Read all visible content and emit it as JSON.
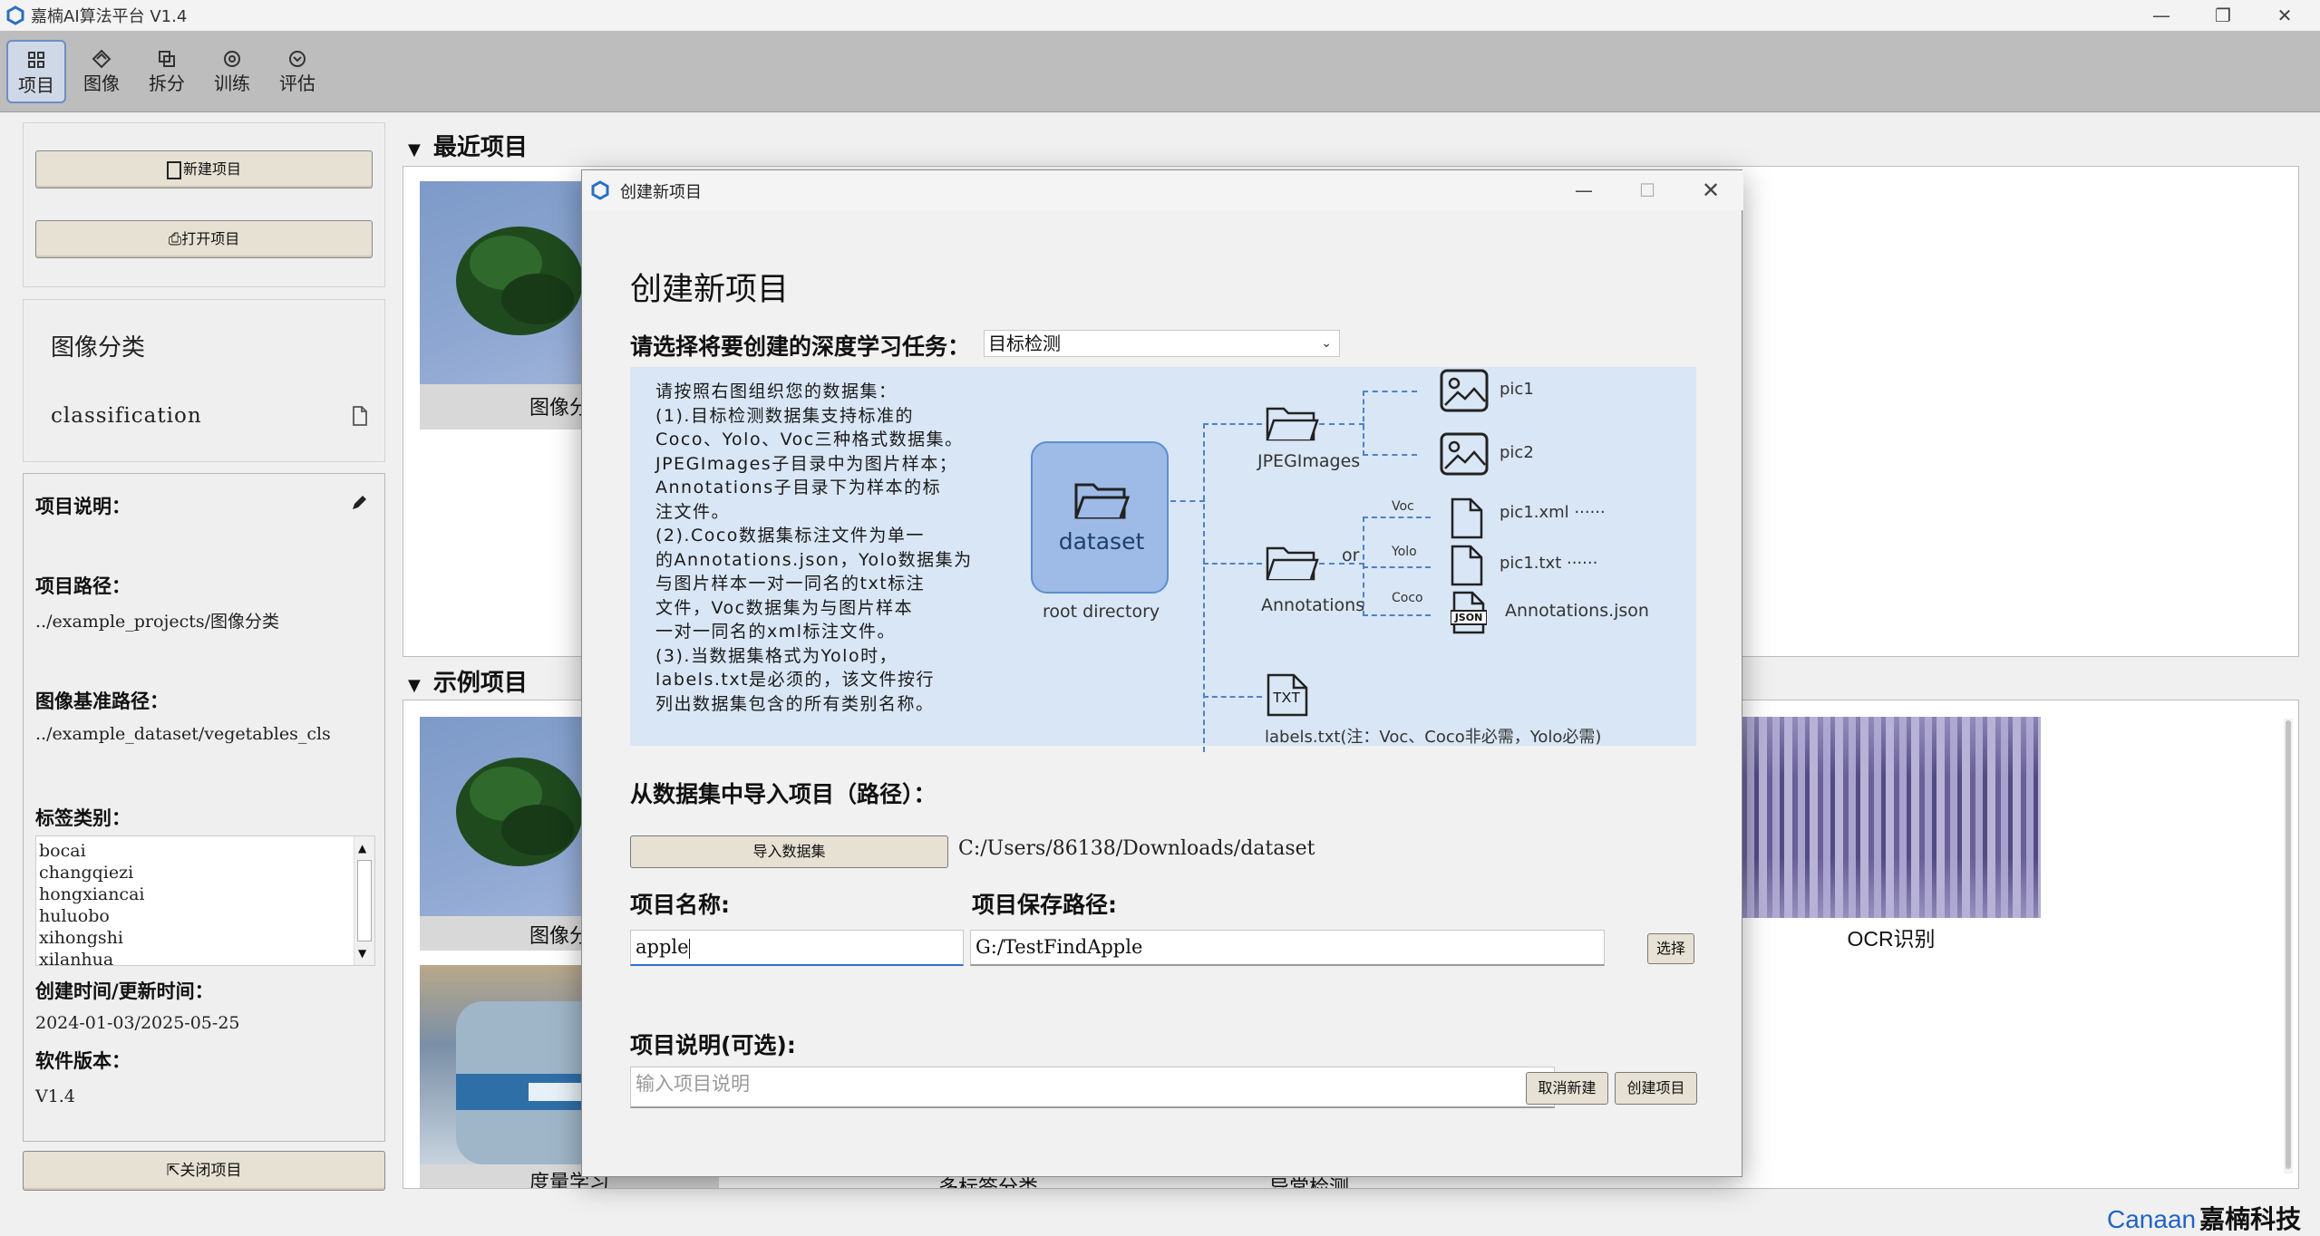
{
  "window": {
    "title": "嘉楠AI算法平台 V1.4",
    "controls": {
      "minimize": "—",
      "restore": "❐",
      "close": "✕"
    }
  },
  "toolbar": {
    "items": [
      {
        "label": "项目",
        "icon": "grid-icon"
      },
      {
        "label": "图像",
        "icon": "image-icon"
      },
      {
        "label": "拆分",
        "icon": "split-icon"
      },
      {
        "label": "训练",
        "icon": "train-icon"
      },
      {
        "label": "评估",
        "icon": "evaluate-icon"
      }
    ]
  },
  "sidebar": {
    "new_project": "新建项目",
    "open_project": "打开项目",
    "project_type": "图像分类",
    "project_name": "classification",
    "description_label": "项目说明：",
    "path_label": "项目路径：",
    "path_value": "../example_projects/图像分类",
    "base_path_label": "图像基准路径：",
    "base_path_value": "../example_dataset/vegetables_cls",
    "labels_label": "标签类别：",
    "labels": [
      "bocai",
      "changqiezi",
      "hongxiancai",
      "huluobo",
      "xihongshi",
      "xilanhua"
    ],
    "time_label": "创建时间/更新时间：",
    "time_value": "2024-01-03/2025-05-25",
    "version_label": "软件版本：",
    "version_value": "V1.4",
    "close_project": "关闭项目"
  },
  "recent": {
    "title": "最近项目",
    "cards": [
      {
        "label": "图像分类"
      }
    ]
  },
  "examples": {
    "title": "示例项目",
    "cards": [
      {
        "label": "图像分类"
      },
      {
        "label": "度量学习"
      },
      {
        "label": "多标签分类"
      },
      {
        "label": "异常检测"
      },
      {
        "label": "OCR识别"
      }
    ]
  },
  "brand": {
    "en": "Canaan",
    "cn": "嘉楠科技"
  },
  "dialog": {
    "window_title": "创建新项目",
    "heading": "创建新项目",
    "task_label": "请选择将要创建的深度学习任务：",
    "task_value": "目标检测",
    "instructions": [
      "请按照右图组织您的数据集：",
      "(1).目标检测数据集支持标准的",
      "Coco、Yolo、Voc三种格式数据集。",
      "JPEGImages子目录中为图片样本；",
      "Annotations子目录下为样本的标",
      "注文件。",
      "(2).Coco数据集标注文件为单一",
      "的Annotations.json，Yolo数据集为",
      "与图片样本一对一同名的txt标注",
      "文件，Voc数据集为与图片样本",
      "一对一同名的xml标注文件。",
      "(3).当数据集格式为Yolo时，",
      "labels.txt是必须的，该文件按行",
      "列出数据集包含的所有类别名称。"
    ],
    "diagram": {
      "dataset": "dataset",
      "root": "root directory",
      "jpeg": "JPEGImages",
      "annotations": "Annotations",
      "or": "or",
      "pic1": "pic1",
      "pic2": "pic2",
      "voc": "Voc",
      "yolo": "Yolo",
      "coco": "Coco",
      "xml": "pic1.xml ······",
      "txt": "pic1.txt ······",
      "json": "Annotations.json",
      "json_badge": "JSON",
      "txt_badge": "TXT",
      "labels_note": "labels.txt(注：Voc、Coco非必需，Yolo必需)"
    },
    "import_label": "从数据集中导入项目（路径）：",
    "import_button": "导入数据集",
    "import_path": "C:/Users/86138/Downloads/dataset",
    "name_label": "项目名称:",
    "name_value": "apple",
    "save_path_label": "项目保存路径:",
    "save_path_value": "G:/TestFindApple",
    "select_button": "选择",
    "desc_label": "项目说明(可选):",
    "desc_placeholder": "输入项目说明",
    "cancel_button": "取消新建",
    "create_button": "创建项目"
  }
}
